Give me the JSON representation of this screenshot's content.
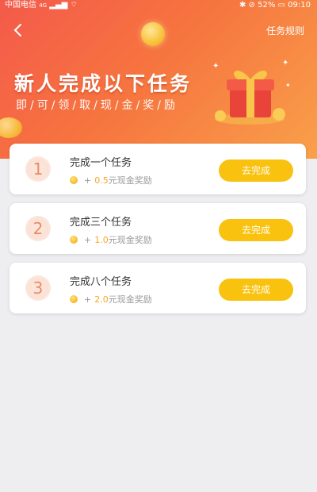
{
  "status_bar": {
    "carrier": "中国电信",
    "network": "4G",
    "battery": "52%",
    "time": "09:10"
  },
  "header": {
    "back_icon": "chevron-left-icon",
    "rules_label": "任务规则"
  },
  "hero": {
    "title": "新人完成以下任务",
    "subtitle": "即/可/领/取/现/金/奖/励"
  },
  "tasks": [
    {
      "number": "1",
      "title": "完成一个任务",
      "plus": "+",
      "amount": "0.5",
      "reward_suffix": "元现金奖励",
      "button": "去完成"
    },
    {
      "number": "2",
      "title": "完成三个任务",
      "plus": "+",
      "amount": "1.0",
      "reward_suffix": "元现金奖励",
      "button": "去完成"
    },
    {
      "number": "3",
      "title": "完成八个任务",
      "plus": "+",
      "amount": "2.0",
      "reward_suffix": "元现金奖励",
      "button": "去完成"
    }
  ],
  "colors": {
    "hero_start": "#f45a4b",
    "hero_end": "#f9a04a",
    "button": "#f9c20f",
    "amount": "#f5a623",
    "number": "#ec8a62"
  }
}
